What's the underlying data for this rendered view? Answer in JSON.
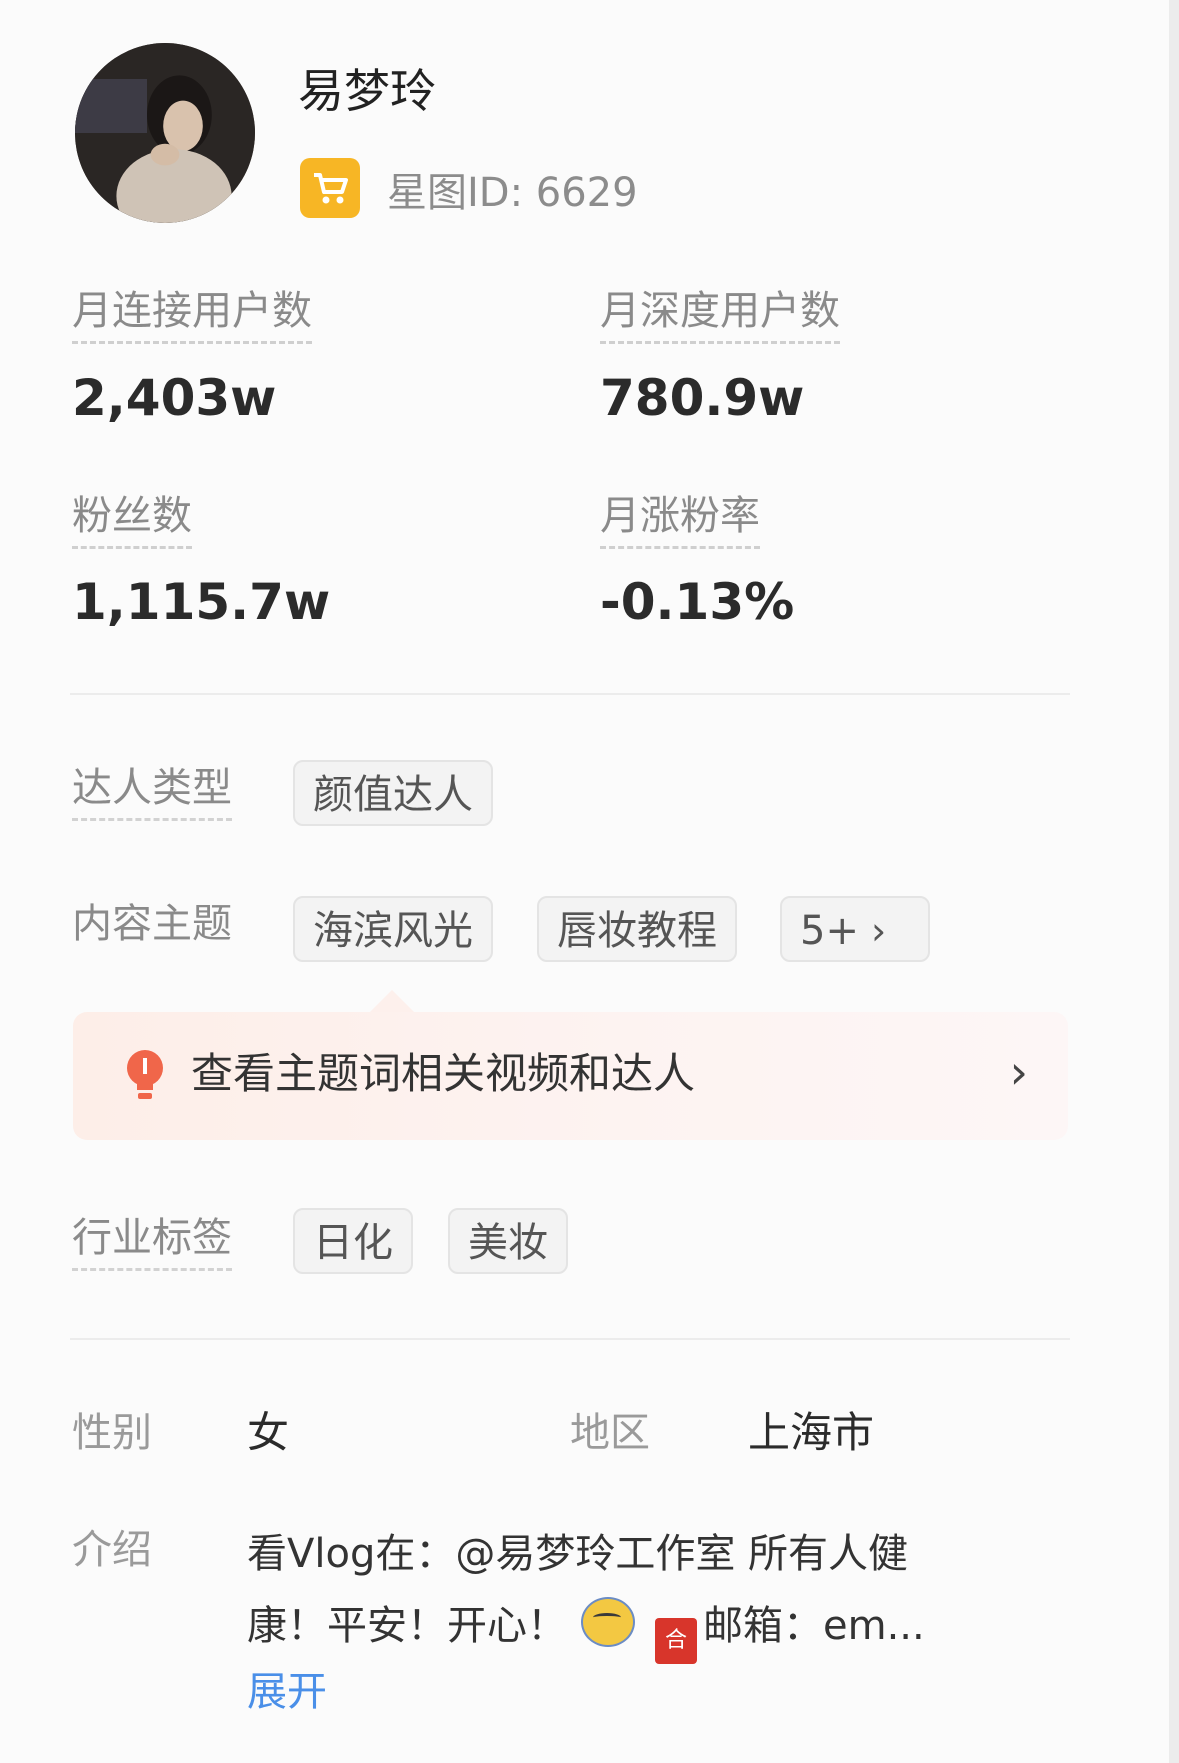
{
  "profile": {
    "name": "易梦玲",
    "xingtu_id": "星图ID: 6629"
  },
  "stats": [
    {
      "label": "月连接用户数",
      "value": "2,403w"
    },
    {
      "label": "月深度用户数",
      "value": "780.9w"
    },
    {
      "label": "粉丝数",
      "value": "1,115.7w"
    },
    {
      "label": "月涨粉率",
      "value": "-0.13%"
    }
  ],
  "creator_type": {
    "label": "达人类型",
    "tags": [
      "颜值达人"
    ]
  },
  "content_topics": {
    "label": "内容主题",
    "tags": [
      "海滨风光",
      "唇妆教程"
    ],
    "more": "5+"
  },
  "tip": {
    "text": "查看主题词相关视频和达人"
  },
  "industry": {
    "label": "行业标签",
    "tags": [
      "日化",
      "美妆"
    ]
  },
  "info": {
    "gender_label": "性别",
    "gender_value": "女",
    "region_label": "地区",
    "region_value": "上海市",
    "intro_label": "介绍",
    "intro_line1": "看Vlog在：@易梦玲工作室 所有人健",
    "intro_line2a": "康！平安！开心！",
    "intro_line2b": "邮箱：em...",
    "expand": "展开"
  },
  "colors": {
    "accent_blue": "#4a8fe8",
    "badge_yellow": "#f7b625",
    "tip_bulb": "#f0664a"
  },
  "icons": [
    "shopping-cart-icon",
    "lightbulb-icon",
    "chevron-right-icon"
  ]
}
